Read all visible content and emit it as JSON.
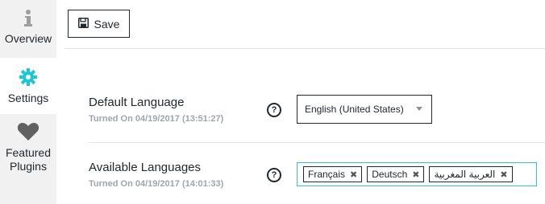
{
  "sidebar": {
    "items": [
      {
        "label": "Overview",
        "icon": "info-icon",
        "active": false
      },
      {
        "label": "Settings",
        "icon": "gear-icon",
        "active": true
      },
      {
        "label": "Featured Plugins",
        "icon": "heart-icon",
        "active": false
      }
    ]
  },
  "toolbar": {
    "save_label": "Save"
  },
  "settings": {
    "default_language": {
      "title": "Default Language",
      "status": "Turned On 04/19/2017 (13:51:27)",
      "selected": "English (United States)"
    },
    "available_languages": {
      "title": "Available Languages",
      "status": "Turned On 04/19/2017 (14:01:33)",
      "tags": [
        "Français",
        "Deutsch",
        "العربية المغربية"
      ]
    }
  },
  "colors": {
    "accent": "#33c3d3",
    "text": "#23282d",
    "muted": "#a0a5aa",
    "sidebar_bg": "#f1f1f1"
  }
}
